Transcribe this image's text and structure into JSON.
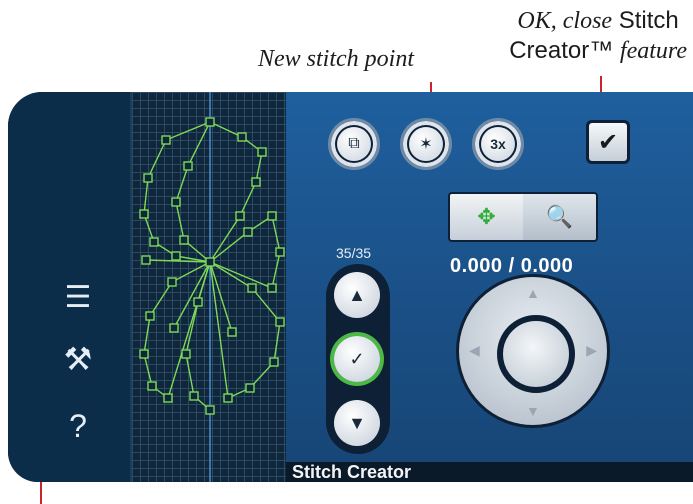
{
  "callouts": {
    "ok_close_line1_italic": "OK, close",
    "ok_close_line1_rest": "Stitch",
    "ok_close_line2_start": "Creator™",
    "ok_close_line2_italic": "feature",
    "new_stitch_point": "New stitch point"
  },
  "left_bar": {
    "menu_icon": "☰",
    "tools_icon": "⚒",
    "help_icon": "?"
  },
  "panel": {
    "counter": "35/35",
    "coordinates": "0.000 / 0.000",
    "footer_title": "Stitch Creator",
    "ok_glyph": "✔",
    "copy_glyph": "⧉",
    "new_point_glyph": "✶",
    "triple_glyph": "3x",
    "move_glyph": "✥",
    "zoom_glyph": "🔍",
    "up_glyph": "▲",
    "down_glyph": "▼",
    "select_glyph": "✓"
  },
  "colors": {
    "accent_red": "#c8262c",
    "screen_bg": "#0c2d4a",
    "stitch_green": "#7ed957"
  }
}
